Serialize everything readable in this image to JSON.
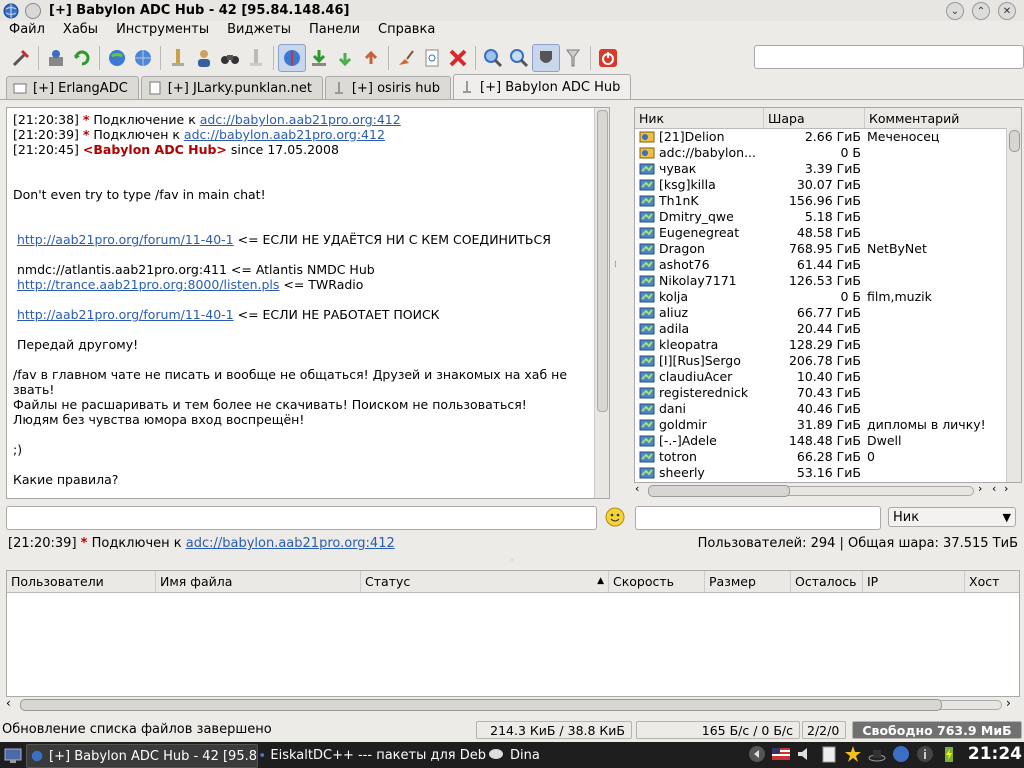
{
  "window": {
    "title": "[+] Babylon ADC Hub - 42 [95.84.148.46]"
  },
  "menu": [
    "Файл",
    "Хабы",
    "Инструменты",
    "Виджеты",
    "Панели",
    "Справка"
  ],
  "tabs": [
    {
      "label": "[+] ErlangADC",
      "active": false
    },
    {
      "label": "[+] JLarky.punklan.net",
      "active": false
    },
    {
      "label": "[+] osiris hub",
      "active": false
    },
    {
      "label": "[+] Babylon ADC Hub",
      "active": true
    }
  ],
  "chat": {
    "l1_time": "[21:20:38]",
    "l1_star": "*",
    "l1_text": " Подключение к ",
    "l1_link": "adc://babylon.aab21pro.org:412",
    "l2_time": "[21:20:39]",
    "l2_star": "*",
    "l2_text": " Подключен к ",
    "l2_link": "adc://babylon.aab21pro.org:412",
    "l3_time": "[21:20:45]",
    "l3_nick": "<Babylon ADC Hub>",
    "l3_text": " since 17.05.2008",
    "m1": "Don't even try to type /fav in main chat!",
    "m2_link": "http://aab21pro.org/forum/11-40-1",
    "m2_text": " <= ЕСЛИ НЕ УДАЁТСЯ НИ С КЕМ СОЕДИНИТЬСЯ",
    "m3": " nmdc://atlantis.aab21pro.org:411 <= Atlantis NMDC Hub",
    "m4_link": "http://trance.aab21pro.org:8000/listen.pls",
    "m4_text": " <= TWRadio",
    "m5_link": "http://aab21pro.org/forum/11-40-1",
    "m5_text": " <= ЕСЛИ НЕ РАБОТАЕТ ПОИСК",
    "m6": " Передай другому!",
    "m7": "/fav в главном чате не писать и вообще не общаться! Друзей и знакомых на хаб не звать!",
    "m8": "Файлы не расшаривать и тем более не скачивать! Поиском не пользоваться!",
    "m9": "Людям без чувства юмора вход воспрещён!",
    "m10": ";)",
    "m11": "Какие правила?"
  },
  "userlist": {
    "headers": {
      "nick": "Ник",
      "share": "Шара",
      "comment": "Комментарий"
    },
    "rows": [
      {
        "nick": "[21]Delion",
        "share": "2.66 ГиБ",
        "comment": "Меченосец",
        "icon": "op-user-icon"
      },
      {
        "nick": "adc://babylon...",
        "share": "0 Б",
        "comment": "",
        "icon": "op-user-icon"
      },
      {
        "nick": "чувак",
        "share": "3.39 ГиБ",
        "comment": "",
        "icon": "user-icon"
      },
      {
        "nick": "[ksg]killa",
        "share": "30.07 ГиБ",
        "comment": "",
        "icon": "user-icon"
      },
      {
        "nick": "Th1nK",
        "share": "156.96 ГиБ",
        "comment": "",
        "icon": "user-icon"
      },
      {
        "nick": "Dmitry_qwe",
        "share": "5.18 ГиБ",
        "comment": "",
        "icon": "user-icon"
      },
      {
        "nick": "Eugenegreat",
        "share": "48.58 ГиБ",
        "comment": "",
        "icon": "user-icon"
      },
      {
        "nick": "Dragon",
        "share": "768.95 ГиБ",
        "comment": "NetByNet",
        "icon": "user-icon"
      },
      {
        "nick": "ashot76",
        "share": "61.44 ГиБ",
        "comment": "",
        "icon": "user-icon"
      },
      {
        "nick": "Nikolay7171",
        "share": "126.53 ГиБ",
        "comment": "",
        "icon": "user-icon"
      },
      {
        "nick": "kolja",
        "share": "0 Б",
        "comment": "film,muzik",
        "icon": "user-icon"
      },
      {
        "nick": "aliuz",
        "share": "66.77 ГиБ",
        "comment": "",
        "icon": "user-icon"
      },
      {
        "nick": "adila",
        "share": "20.44 ГиБ",
        "comment": "",
        "icon": "user-icon"
      },
      {
        "nick": "kleopatra",
        "share": "128.29 ГиБ",
        "comment": "",
        "icon": "user-icon"
      },
      {
        "nick": "[I][Rus]Sergo",
        "share": "206.78 ГиБ",
        "comment": "",
        "icon": "user-icon"
      },
      {
        "nick": "claudiuAcer",
        "share": "10.40 ГиБ",
        "comment": "",
        "icon": "user-icon"
      },
      {
        "nick": "registerednick",
        "share": "70.43 ГиБ",
        "comment": "",
        "icon": "user-icon"
      },
      {
        "nick": "dani",
        "share": "40.46 ГиБ",
        "comment": "",
        "icon": "user-icon"
      },
      {
        "nick": "goldmir",
        "share": "31.89 ГиБ",
        "comment": "дипломы в личку!",
        "icon": "user-icon"
      },
      {
        "nick": "[-.-]Adele",
        "share": "148.48 ГиБ",
        "comment": "Dwell",
        "icon": "user-icon"
      },
      {
        "nick": "totron",
        "share": "66.28 ГиБ",
        "comment": "0",
        "icon": "user-icon"
      },
      {
        "nick": "sheerly",
        "share": "53.16 ГиБ",
        "comment": "",
        "icon": "user-icon"
      }
    ]
  },
  "filter": {
    "selected": "Ник"
  },
  "hub_status": {
    "time": "[21:20:39]",
    "star": "*",
    "text": " Подключен к ",
    "link": "adc://babylon.aab21pro.org:412",
    "right": "Пользователей: 294 | Общая шара: 37.515 ТиБ"
  },
  "transfers": {
    "headers": [
      "Пользователи",
      "Имя файла",
      "Статус",
      "Скорость",
      "Размер",
      "Осталось",
      "IP",
      "Хост"
    ],
    "sort_arrow": "▲"
  },
  "statusbar": {
    "message": "Обновление списка файлов завершено",
    "traffic": "214.3 КиБ / 38.8 КиБ",
    "speed": "165 Б/с / 0 Б/с",
    "slots": "2/2/0",
    "free": "Свободно 763.9 МиБ"
  },
  "taskbar": {
    "tasks": [
      {
        "label": "[+] Babylon ADC Hub - 42 [95.8",
        "active": true
      },
      {
        "label": "EiskaltDC++ --- пакеты для Deb",
        "active": false
      },
      {
        "label": "Dina",
        "active": false
      }
    ],
    "clock": "21:24"
  },
  "colors": {
    "link": "#2a5db0",
    "star": "#c00000",
    "accent": "#7a9e3a"
  }
}
